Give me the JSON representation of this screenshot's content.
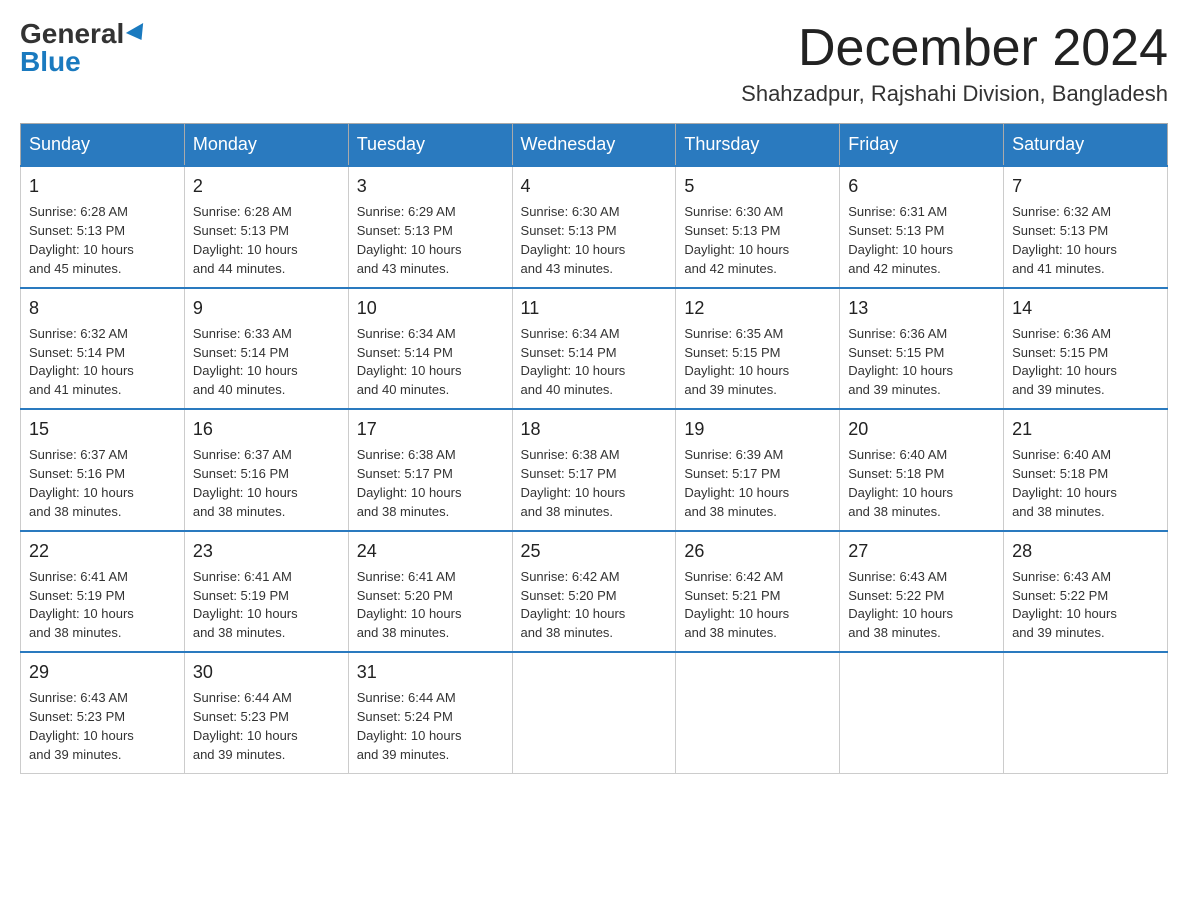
{
  "logo": {
    "general": "General",
    "blue": "Blue"
  },
  "title": {
    "month_year": "December 2024",
    "location": "Shahzadpur, Rajshahi Division, Bangladesh"
  },
  "headers": [
    "Sunday",
    "Monday",
    "Tuesday",
    "Wednesday",
    "Thursday",
    "Friday",
    "Saturday"
  ],
  "weeks": [
    [
      {
        "day": "1",
        "sunrise": "6:28 AM",
        "sunset": "5:13 PM",
        "daylight": "10 hours and 45 minutes."
      },
      {
        "day": "2",
        "sunrise": "6:28 AM",
        "sunset": "5:13 PM",
        "daylight": "10 hours and 44 minutes."
      },
      {
        "day": "3",
        "sunrise": "6:29 AM",
        "sunset": "5:13 PM",
        "daylight": "10 hours and 43 minutes."
      },
      {
        "day": "4",
        "sunrise": "6:30 AM",
        "sunset": "5:13 PM",
        "daylight": "10 hours and 43 minutes."
      },
      {
        "day": "5",
        "sunrise": "6:30 AM",
        "sunset": "5:13 PM",
        "daylight": "10 hours and 42 minutes."
      },
      {
        "day": "6",
        "sunrise": "6:31 AM",
        "sunset": "5:13 PM",
        "daylight": "10 hours and 42 minutes."
      },
      {
        "day": "7",
        "sunrise": "6:32 AM",
        "sunset": "5:13 PM",
        "daylight": "10 hours and 41 minutes."
      }
    ],
    [
      {
        "day": "8",
        "sunrise": "6:32 AM",
        "sunset": "5:14 PM",
        "daylight": "10 hours and 41 minutes."
      },
      {
        "day": "9",
        "sunrise": "6:33 AM",
        "sunset": "5:14 PM",
        "daylight": "10 hours and 40 minutes."
      },
      {
        "day": "10",
        "sunrise": "6:34 AM",
        "sunset": "5:14 PM",
        "daylight": "10 hours and 40 minutes."
      },
      {
        "day": "11",
        "sunrise": "6:34 AM",
        "sunset": "5:14 PM",
        "daylight": "10 hours and 40 minutes."
      },
      {
        "day": "12",
        "sunrise": "6:35 AM",
        "sunset": "5:15 PM",
        "daylight": "10 hours and 39 minutes."
      },
      {
        "day": "13",
        "sunrise": "6:36 AM",
        "sunset": "5:15 PM",
        "daylight": "10 hours and 39 minutes."
      },
      {
        "day": "14",
        "sunrise": "6:36 AM",
        "sunset": "5:15 PM",
        "daylight": "10 hours and 39 minutes."
      }
    ],
    [
      {
        "day": "15",
        "sunrise": "6:37 AM",
        "sunset": "5:16 PM",
        "daylight": "10 hours and 38 minutes."
      },
      {
        "day": "16",
        "sunrise": "6:37 AM",
        "sunset": "5:16 PM",
        "daylight": "10 hours and 38 minutes."
      },
      {
        "day": "17",
        "sunrise": "6:38 AM",
        "sunset": "5:17 PM",
        "daylight": "10 hours and 38 minutes."
      },
      {
        "day": "18",
        "sunrise": "6:38 AM",
        "sunset": "5:17 PM",
        "daylight": "10 hours and 38 minutes."
      },
      {
        "day": "19",
        "sunrise": "6:39 AM",
        "sunset": "5:17 PM",
        "daylight": "10 hours and 38 minutes."
      },
      {
        "day": "20",
        "sunrise": "6:40 AM",
        "sunset": "5:18 PM",
        "daylight": "10 hours and 38 minutes."
      },
      {
        "day": "21",
        "sunrise": "6:40 AM",
        "sunset": "5:18 PM",
        "daylight": "10 hours and 38 minutes."
      }
    ],
    [
      {
        "day": "22",
        "sunrise": "6:41 AM",
        "sunset": "5:19 PM",
        "daylight": "10 hours and 38 minutes."
      },
      {
        "day": "23",
        "sunrise": "6:41 AM",
        "sunset": "5:19 PM",
        "daylight": "10 hours and 38 minutes."
      },
      {
        "day": "24",
        "sunrise": "6:41 AM",
        "sunset": "5:20 PM",
        "daylight": "10 hours and 38 minutes."
      },
      {
        "day": "25",
        "sunrise": "6:42 AM",
        "sunset": "5:20 PM",
        "daylight": "10 hours and 38 minutes."
      },
      {
        "day": "26",
        "sunrise": "6:42 AM",
        "sunset": "5:21 PM",
        "daylight": "10 hours and 38 minutes."
      },
      {
        "day": "27",
        "sunrise": "6:43 AM",
        "sunset": "5:22 PM",
        "daylight": "10 hours and 38 minutes."
      },
      {
        "day": "28",
        "sunrise": "6:43 AM",
        "sunset": "5:22 PM",
        "daylight": "10 hours and 39 minutes."
      }
    ],
    [
      {
        "day": "29",
        "sunrise": "6:43 AM",
        "sunset": "5:23 PM",
        "daylight": "10 hours and 39 minutes."
      },
      {
        "day": "30",
        "sunrise": "6:44 AM",
        "sunset": "5:23 PM",
        "daylight": "10 hours and 39 minutes."
      },
      {
        "day": "31",
        "sunrise": "6:44 AM",
        "sunset": "5:24 PM",
        "daylight": "10 hours and 39 minutes."
      },
      null,
      null,
      null,
      null
    ]
  ],
  "labels": {
    "sunrise": "Sunrise:",
    "sunset": "Sunset:",
    "daylight": "Daylight:"
  }
}
